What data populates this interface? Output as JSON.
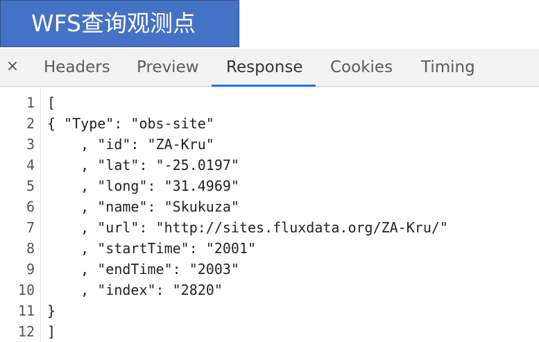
{
  "banner": {
    "title": "WFS查询观测点"
  },
  "devtools": {
    "close_icon": "×",
    "tabs": [
      {
        "label": "Headers",
        "active": false
      },
      {
        "label": "Preview",
        "active": false
      },
      {
        "label": "Response",
        "active": true
      },
      {
        "label": "Cookies",
        "active": false
      },
      {
        "label": "Timing",
        "active": false
      }
    ],
    "accent_color": "#1a73e8"
  },
  "response": {
    "lines": [
      {
        "num": "1",
        "text": "["
      },
      {
        "num": "2",
        "text": "{ \"Type\": \"obs-site\""
      },
      {
        "num": "3",
        "text": "    , \"id\": \"ZA-Kru\""
      },
      {
        "num": "4",
        "text": "    , \"lat\": \"-25.0197\""
      },
      {
        "num": "5",
        "text": "    , \"long\": \"31.4969\""
      },
      {
        "num": "6",
        "text": "    , \"name\": \"Skukuza\""
      },
      {
        "num": "7",
        "text": "    , \"url\": \"http://sites.fluxdata.org/ZA-Kru/\""
      },
      {
        "num": "8",
        "text": "    , \"startTime\": \"2001\""
      },
      {
        "num": "9",
        "text": "    , \"endTime\": \"2003\""
      },
      {
        "num": "10",
        "text": "    , \"index\": \"2820\""
      },
      {
        "num": "11",
        "text": "}"
      },
      {
        "num": "12",
        "text": "]"
      }
    ]
  }
}
